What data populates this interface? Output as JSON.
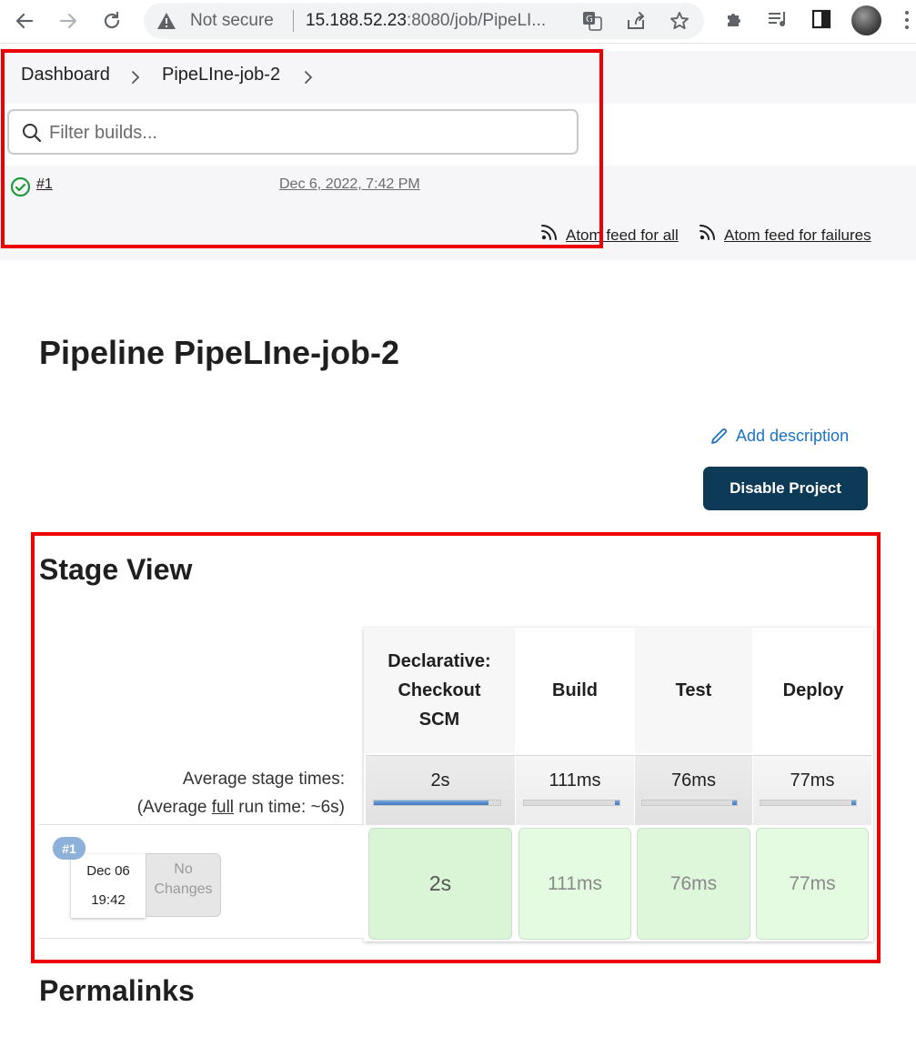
{
  "browser": {
    "security_label": "Not secure",
    "url_host": "15.188.52.23",
    "url_rest": ":8080/job/PipeLI..."
  },
  "breadcrumb": {
    "items": [
      "Dashboard",
      "PipeLIne-job-2"
    ]
  },
  "build_history": {
    "filter_placeholder": "Filter builds...",
    "builds": [
      {
        "number": "#1",
        "date": "Dec 6, 2022, 7:42 PM",
        "status": "success"
      }
    ],
    "feeds": {
      "all": "Atom feed for all",
      "failures": "Atom feed for failures"
    }
  },
  "main": {
    "title": "Pipeline PipeLIne-job-2",
    "add_description": "Add description",
    "disable_button": "Disable Project",
    "permalinks_title": "Permalinks"
  },
  "stage_view": {
    "title": "Stage View",
    "avg_label": "Average stage times:",
    "full_run_prefix": "(Average ",
    "full_run_link": "full",
    "full_run_suffix": " run time: ~6s)",
    "stages": [
      {
        "name": "Declarative: Checkout SCM",
        "name_lines": [
          "Declarative:",
          "Checkout",
          "SCM"
        ],
        "avg": "2s",
        "share": 0.91,
        "result": "2s"
      },
      {
        "name": "Build",
        "name_lines": [
          "Build"
        ],
        "avg": "111ms",
        "share": 0.05,
        "result": "111ms"
      },
      {
        "name": "Test",
        "name_lines": [
          "Test"
        ],
        "avg": "76ms",
        "share": 0.04,
        "result": "76ms"
      },
      {
        "name": "Deploy",
        "name_lines": [
          "Deploy"
        ],
        "avg": "77ms",
        "share": 0.04,
        "result": "77ms"
      }
    ],
    "run": {
      "badge": "#1",
      "date": "Dec 06",
      "time": "19:42",
      "changes_line1": "No",
      "changes_line2": "Changes"
    }
  },
  "colors": {
    "primary_button": "#0d3b57",
    "link_blue": "#1a73c7",
    "success_green": "#1e9b3b",
    "stage_success_bg": "#e4fbe1",
    "highlight_red": "#ee0000"
  },
  "icons": {
    "back": "arrow-left-icon",
    "forward": "arrow-right-icon",
    "reload": "reload-icon",
    "warning": "warning-icon",
    "translate": "translate-icon",
    "share": "share-icon",
    "bookmark": "star-icon",
    "extensions": "puzzle-icon",
    "media": "media-queue-icon",
    "sidepanel": "side-panel-icon",
    "search": "search-icon",
    "feed": "rss-icon",
    "edit": "pencil-icon",
    "success": "check-circle-icon"
  }
}
